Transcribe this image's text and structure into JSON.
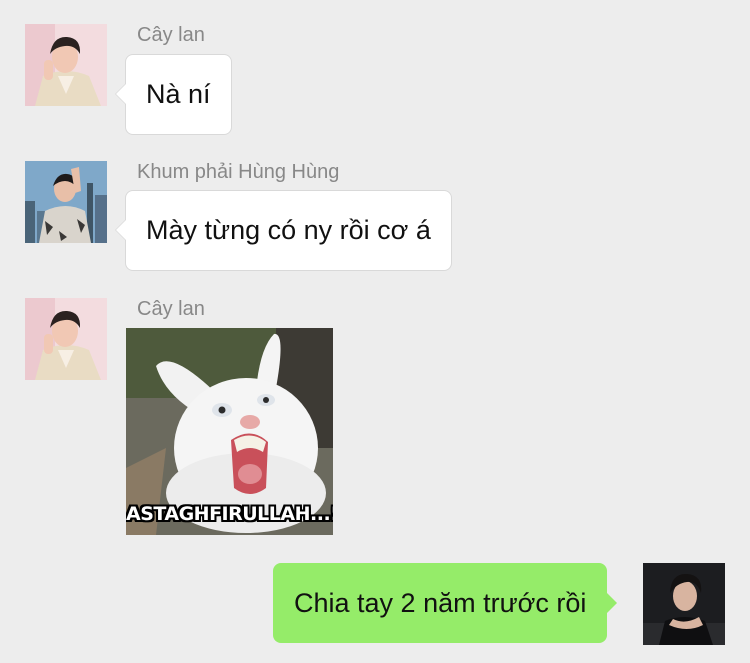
{
  "messages": [
    {
      "sender": "Cây lan",
      "text": "Nà ní",
      "direction": "incoming",
      "avatar": "avatar-pink-jacket"
    },
    {
      "sender": "Khum phải Hùng Hùng",
      "text": "Mày từng có ny rồi cơ á",
      "direction": "incoming",
      "avatar": "avatar-city-skyline"
    },
    {
      "sender": "Cây lan",
      "type": "sticker",
      "sticker_name": "screaming-rabbit-sticker",
      "caption": "ASTAGHFIRULLAH...!!!",
      "direction": "incoming",
      "avatar": "avatar-pink-jacket"
    },
    {
      "text": "Chia tay 2 năm trước rồi",
      "direction": "outgoing",
      "avatar": "avatar-dark-portrait"
    }
  ],
  "colors": {
    "background": "#ededed",
    "incoming_bubble": "#ffffff",
    "outgoing_bubble": "#95ec69",
    "sender_name": "#888888"
  }
}
